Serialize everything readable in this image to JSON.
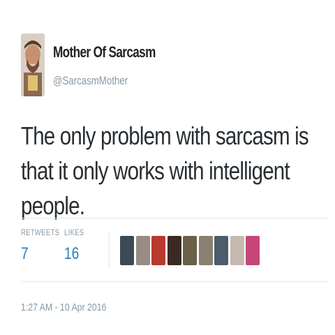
{
  "user": {
    "display_name": "Mother Of Sarcasm",
    "handle": "@SarcasmMother"
  },
  "tweet": {
    "text": "The only problem with sarcasm is that it only works with intelligent people."
  },
  "stats": {
    "retweets_label": "RETWEETS",
    "retweets_count": "7",
    "likes_label": "LIKES",
    "likes_count": "16"
  },
  "likers": [
    {
      "color": "#3c4a55"
    },
    {
      "color": "#9a8c84"
    },
    {
      "color": "#b83a2e"
    },
    {
      "color": "#3a2a22"
    },
    {
      "color": "#6b6048"
    },
    {
      "color": "#8a8070"
    },
    {
      "color": "#4c5c6a"
    },
    {
      "color": "#c6b9b0"
    },
    {
      "color": "#c8457a"
    }
  ],
  "timestamp": "1:27 AM - 10 Apr 2016"
}
